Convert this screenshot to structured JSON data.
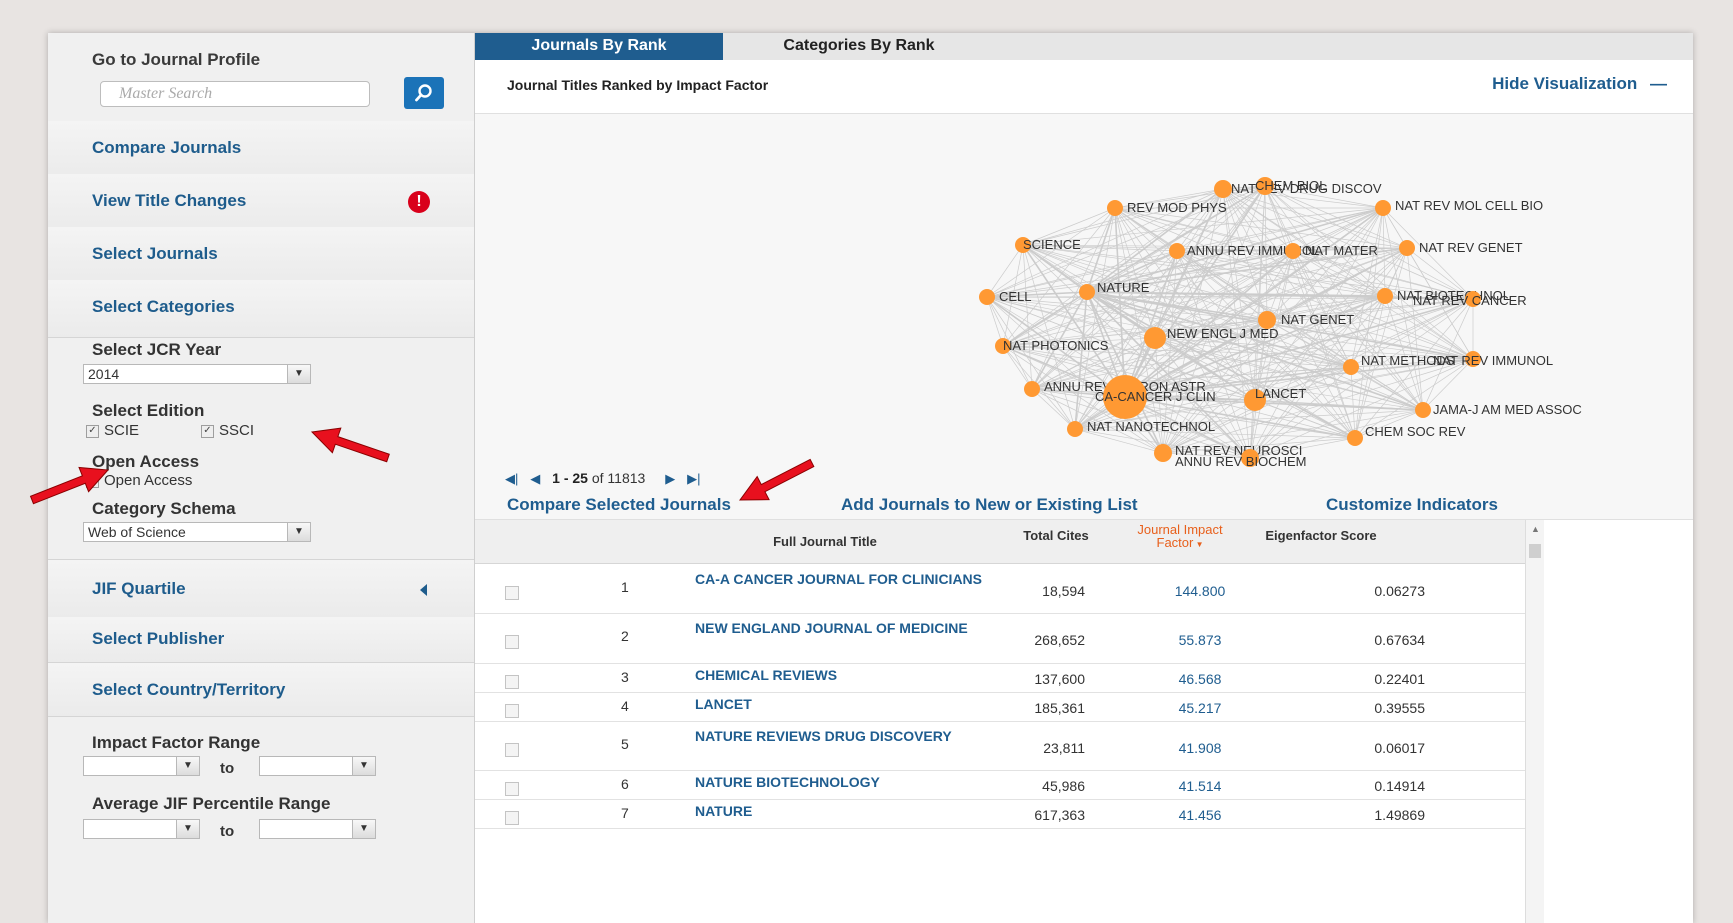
{
  "sidebar": {
    "goto_title": "Go to Journal Profile",
    "search_placeholder": "Master Search",
    "items": {
      "compare": "Compare Journals",
      "title_changes": "View Title Changes",
      "select_journals": "Select Journals",
      "select_categories": "Select Categories",
      "jif_quartile": "JIF Quartile",
      "select_publisher": "Select Publisher",
      "select_country": "Select Country/Territory"
    },
    "jcr_year": {
      "label": "Select JCR Year",
      "value": "2014"
    },
    "edition": {
      "label": "Select Edition",
      "options": [
        "SCIE",
        "SSCI"
      ]
    },
    "open_access": {
      "label": "Open Access",
      "option": "Open Access"
    },
    "category_schema": {
      "label": "Category Schema",
      "value": "Web of Science"
    },
    "impact_range": {
      "label": "Impact Factor Range",
      "to": "to"
    },
    "percentile_range": {
      "label": "Average JIF Percentile Range",
      "to": "to"
    }
  },
  "tabs": {
    "active": "Journals By Rank",
    "inactive": "Categories By Rank"
  },
  "main": {
    "subtitle": "Journal Titles Ranked by Impact Factor",
    "hide_vis": "Hide Visualization",
    "hide_vis_icon": "—",
    "pager": {
      "range": "1 - 25",
      "of_text": "of 11813"
    },
    "actions": {
      "compare": "Compare Selected Journals",
      "add_list": "Add Journals to New or Existing List",
      "customize": "Customize Indicators"
    }
  },
  "network": {
    "node_color": "#ff9933",
    "labels": [
      "NAT REV DRUG DISCOV",
      "CHEM BIOL",
      "REV MOD PHYS",
      "NAT REV MOL CELL BIO",
      "SCIENCE",
      "ANNU REV IMMUNOL",
      "NAT MATER",
      "NAT REV GENET",
      "CELL",
      "NATURE",
      "NAT BIOTECHNOL",
      "NAT REV CANCER",
      "NAT GENET",
      "NAT PHOTONICS",
      "NEW ENGL J MED",
      "NAT REV IMMUNOL",
      "NAT METHODS",
      "ANNU REV ASTRON ASTR",
      "CA-CANCER J CLIN",
      "LANCET",
      "JAMA-J AM MED ASSOC",
      "NAT NANOTECHNOL",
      "CHEM SOC REV",
      "NAT REV NEUROSCI",
      "ANNU REV BIOCHEM"
    ]
  },
  "table": {
    "headers": {
      "title": "Full Journal Title",
      "cites": "Total Cites",
      "jif": "Journal Impact Factor",
      "eigen": "Eigenfactor Score"
    },
    "rows": [
      {
        "rank": "1",
        "title": "CA-A CANCER JOURNAL FOR CLINICIANS",
        "cites": "18,594",
        "jif": "144.800",
        "eigen": "0.06273"
      },
      {
        "rank": "2",
        "title": "NEW ENGLAND JOURNAL OF MEDICINE",
        "cites": "268,652",
        "jif": "55.873",
        "eigen": "0.67634"
      },
      {
        "rank": "3",
        "title": "CHEMICAL REVIEWS",
        "cites": "137,600",
        "jif": "46.568",
        "eigen": "0.22401"
      },
      {
        "rank": "4",
        "title": "LANCET",
        "cites": "185,361",
        "jif": "45.217",
        "eigen": "0.39555"
      },
      {
        "rank": "5",
        "title": "NATURE REVIEWS DRUG DISCOVERY",
        "cites": "23,811",
        "jif": "41.908",
        "eigen": "0.06017"
      },
      {
        "rank": "6",
        "title": "NATURE BIOTECHNOLOGY",
        "cites": "45,986",
        "jif": "41.514",
        "eigen": "0.14914"
      },
      {
        "rank": "7",
        "title": "NATURE",
        "cites": "617,363",
        "jif": "41.456",
        "eigen": "1.49869"
      }
    ]
  },
  "colors": {
    "accent": "#1f5d8f",
    "annotation_arrow": "#e8101e",
    "jif_header": "#e8601c"
  }
}
